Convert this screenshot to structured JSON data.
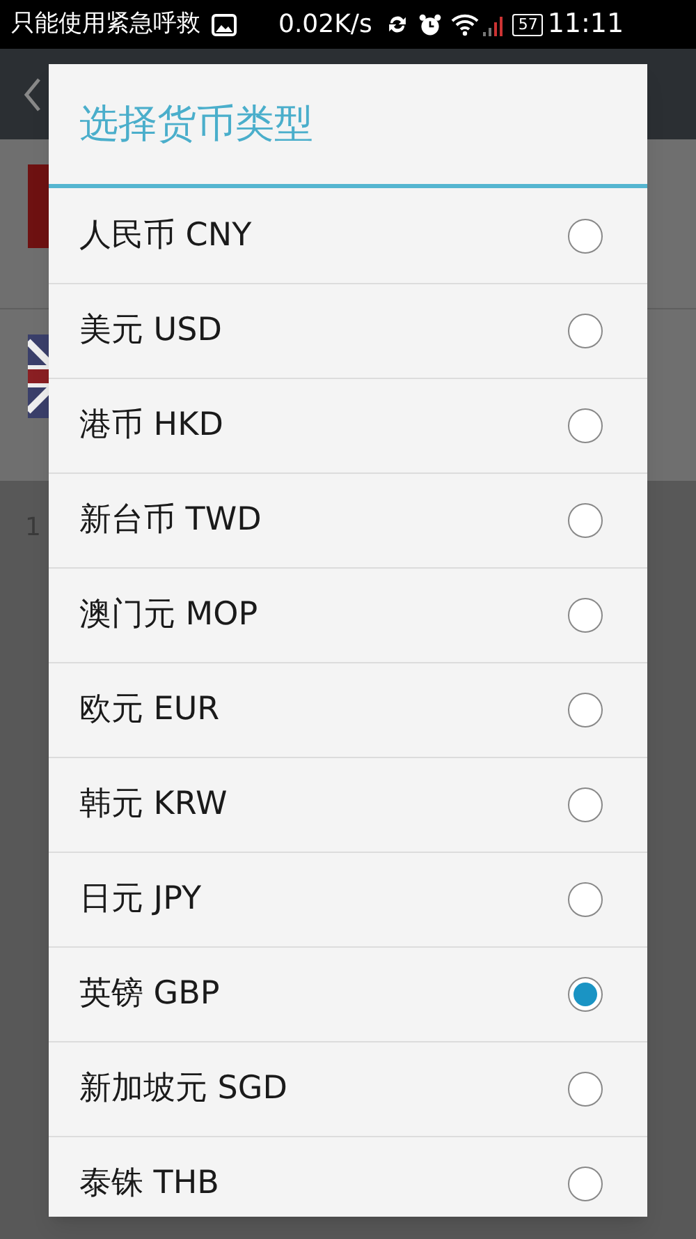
{
  "status_bar": {
    "notice": "只能使用紧急呼救",
    "speed": "0.02K/s",
    "battery": "57",
    "time": "11:11"
  },
  "background": {
    "row_text": "1"
  },
  "dialog": {
    "title": "选择货币类型",
    "options": [
      {
        "label": "人民币 CNY",
        "selected": false
      },
      {
        "label": "美元 USD",
        "selected": false
      },
      {
        "label": "港币 HKD",
        "selected": false
      },
      {
        "label": "新台币 TWD",
        "selected": false
      },
      {
        "label": "澳门元 MOP",
        "selected": false
      },
      {
        "label": "欧元 EUR",
        "selected": false
      },
      {
        "label": "韩元 KRW",
        "selected": false
      },
      {
        "label": "日元 JPY",
        "selected": false
      },
      {
        "label": "英镑 GBP",
        "selected": true
      },
      {
        "label": "新加坡元 SGD",
        "selected": false
      },
      {
        "label": "泰铢 THB",
        "selected": false
      }
    ]
  }
}
